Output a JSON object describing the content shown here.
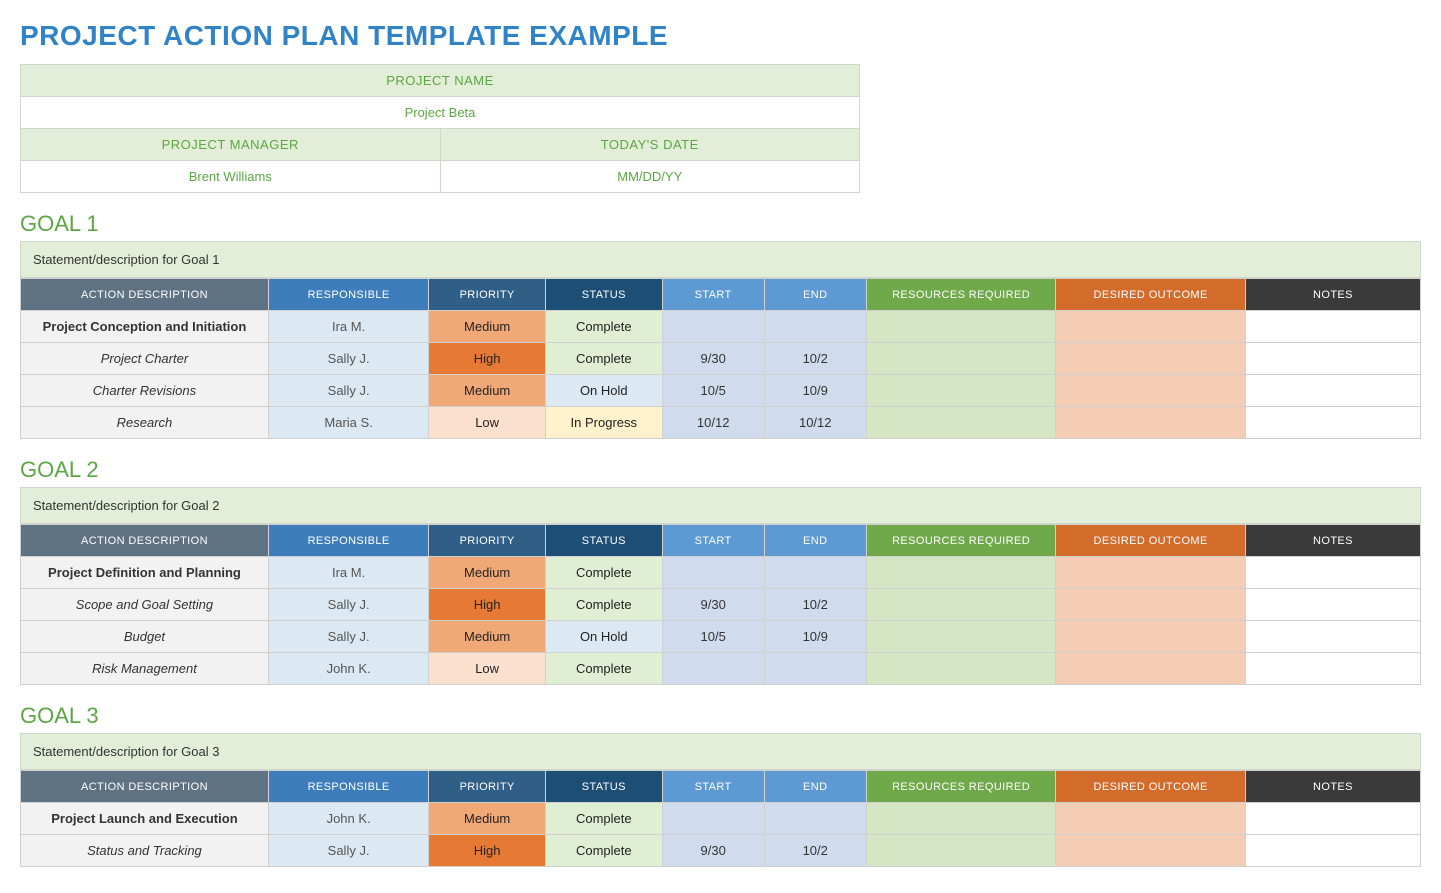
{
  "header": {
    "title": "PROJECT ACTION PLAN TEMPLATE EXAMPLE"
  },
  "meta": {
    "project_name_label": "PROJECT NAME",
    "project_name": "Project Beta",
    "project_manager_label": "PROJECT MANAGER",
    "project_manager": "Brent Williams",
    "todays_date_label": "TODAY'S DATE",
    "todays_date": "MM/DD/YY"
  },
  "columns": {
    "action": "ACTION DESCRIPTION",
    "responsible": "RESPONSIBLE",
    "priority": "PRIORITY",
    "status": "STATUS",
    "start": "START",
    "end": "END",
    "resources": "RESOURCES REQUIRED",
    "outcome": "DESIRED OUTCOME",
    "notes": "NOTES"
  },
  "goals": [
    {
      "title": "GOAL 1",
      "statement": "Statement/description for Goal 1",
      "rows": [
        {
          "action": "Project Conception and Initiation",
          "main": true,
          "responsible": "Ira M.",
          "priority": "Medium",
          "status": "Complete",
          "start": "",
          "end": "",
          "resources": "",
          "outcome": "",
          "notes": ""
        },
        {
          "action": "Project Charter",
          "main": false,
          "responsible": "Sally J.",
          "priority": "High",
          "status": "Complete",
          "start": "9/30",
          "end": "10/2",
          "resources": "",
          "outcome": "",
          "notes": ""
        },
        {
          "action": "Charter Revisions",
          "main": false,
          "responsible": "Sally J.",
          "priority": "Medium",
          "status": "On Hold",
          "start": "10/5",
          "end": "10/9",
          "resources": "",
          "outcome": "",
          "notes": ""
        },
        {
          "action": "Research",
          "main": false,
          "responsible": "Maria S.",
          "priority": "Low",
          "status": "In Progress",
          "start": "10/12",
          "end": "10/12",
          "resources": "",
          "outcome": "",
          "notes": ""
        }
      ]
    },
    {
      "title": "GOAL 2",
      "statement": "Statement/description for Goal 2",
      "rows": [
        {
          "action": "Project Definition and Planning",
          "main": true,
          "responsible": "Ira M.",
          "priority": "Medium",
          "status": "Complete",
          "start": "",
          "end": "",
          "resources": "",
          "outcome": "",
          "notes": ""
        },
        {
          "action": "Scope and Goal Setting",
          "main": false,
          "responsible": "Sally J.",
          "priority": "High",
          "status": "Complete",
          "start": "9/30",
          "end": "10/2",
          "resources": "",
          "outcome": "",
          "notes": ""
        },
        {
          "action": "Budget",
          "main": false,
          "responsible": "Sally J.",
          "priority": "Medium",
          "status": "On Hold",
          "start": "10/5",
          "end": "10/9",
          "resources": "",
          "outcome": "",
          "notes": ""
        },
        {
          "action": "Risk Management",
          "main": false,
          "responsible": "John K.",
          "priority": "Low",
          "status": "Complete",
          "start": "",
          "end": "",
          "resources": "",
          "outcome": "",
          "notes": ""
        }
      ]
    },
    {
      "title": "GOAL 3",
      "statement": "Statement/description for Goal 3",
      "rows": [
        {
          "action": "Project Launch and Execution",
          "main": true,
          "responsible": "John K.",
          "priority": "Medium",
          "status": "Complete",
          "start": "",
          "end": "",
          "resources": "",
          "outcome": "",
          "notes": ""
        },
        {
          "action": "Status and Tracking",
          "main": false,
          "responsible": "Sally J.",
          "priority": "High",
          "status": "Complete",
          "start": "9/30",
          "end": "10/2",
          "resources": "",
          "outcome": "",
          "notes": ""
        }
      ]
    }
  ]
}
